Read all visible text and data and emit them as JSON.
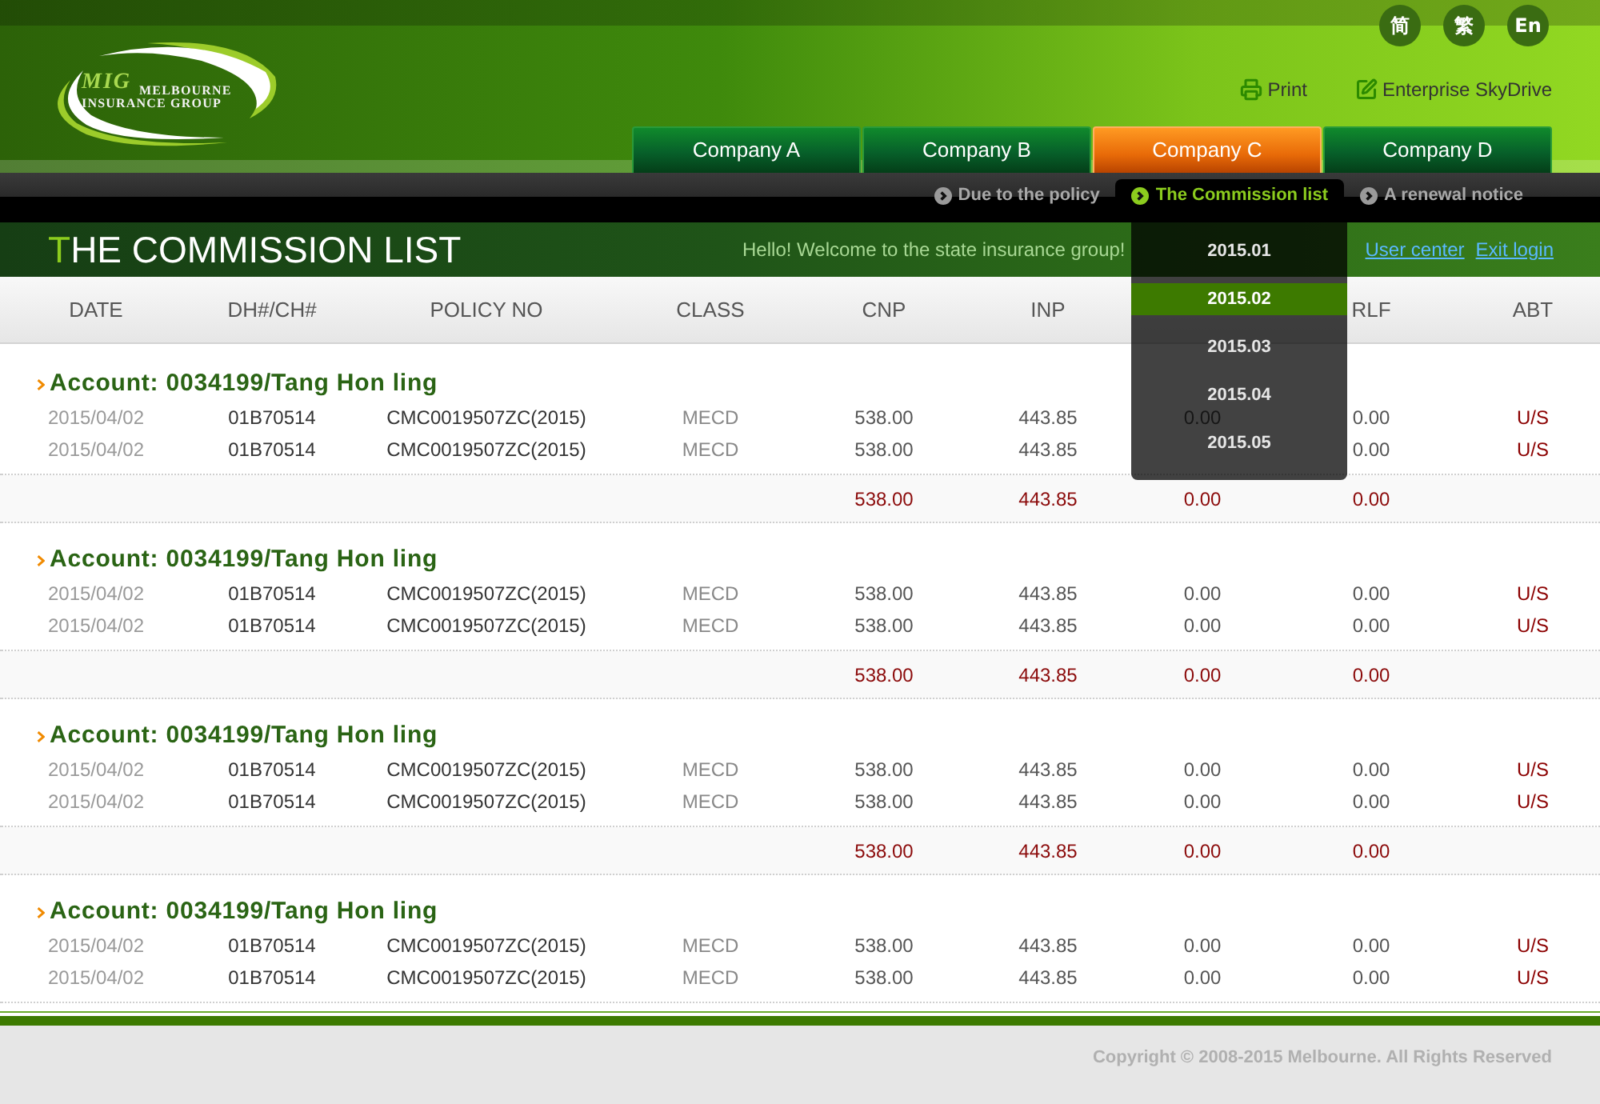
{
  "header": {
    "logo": {
      "mark": "MIG",
      "name": "MELBOURNE",
      "tagline": "INSURANCE GROUP"
    },
    "languages": [
      "简",
      "繁",
      "En"
    ],
    "tools": [
      {
        "kind": "print",
        "label": "Print"
      },
      {
        "kind": "edit",
        "label": "Enterprise SkyDrive"
      }
    ]
  },
  "tabs": [
    {
      "label": "Company A",
      "selected": false
    },
    {
      "label": "Company B",
      "selected": false
    },
    {
      "label": "Company C",
      "selected": true
    },
    {
      "label": "Company D",
      "selected": false
    }
  ],
  "subnav": [
    {
      "label": "Due to the policy",
      "selected": false
    },
    {
      "label": "The Commission list",
      "selected": true
    },
    {
      "label": "A renewal notice",
      "selected": false
    }
  ],
  "month_menu": {
    "items": [
      {
        "label": "2015.01",
        "selected": false
      },
      {
        "label": "2015.02",
        "selected": true
      },
      {
        "label": "2015.03",
        "selected": false
      },
      {
        "label": "2015.04",
        "selected": false
      },
      {
        "label": "2015.05",
        "selected": false
      }
    ]
  },
  "title_bar": {
    "title": "THE COMMISSION LIST",
    "welcome": "Hello! Welcome to the state insurance group!",
    "links": [
      "User center",
      "Exit login"
    ]
  },
  "table": {
    "columns": [
      "DATE",
      "DH#/CH#",
      "POLICY NO",
      "CLASS",
      "CNP",
      "INP",
      null,
      "RLF",
      "ABT"
    ],
    "groups": [
      {
        "account": "Account: 0034199/Tang Hon ling",
        "rows": [
          [
            "2015/04/02",
            "01B70514",
            "CMC0019507ZC(2015)",
            "MECD",
            "538.00",
            "443.85",
            "0.00",
            "0.00",
            "U/S"
          ],
          [
            "2015/04/02",
            "01B70514",
            "CMC0019507ZC(2015)",
            "MECD",
            "538.00",
            "443.85",
            null,
            "0.00",
            "U/S"
          ]
        ],
        "totals": [
          "538.00",
          "443.85",
          "0.00",
          "0.00"
        ]
      },
      {
        "account": "Account: 0034199/Tang Hon ling",
        "rows": [
          [
            "2015/04/02",
            "01B70514",
            "CMC0019507ZC(2015)",
            "MECD",
            "538.00",
            "443.85",
            "0.00",
            "0.00",
            "U/S"
          ],
          [
            "2015/04/02",
            "01B70514",
            "CMC0019507ZC(2015)",
            "MECD",
            "538.00",
            "443.85",
            "0.00",
            "0.00",
            "U/S"
          ]
        ],
        "totals": [
          "538.00",
          "443.85",
          "0.00",
          "0.00"
        ]
      },
      {
        "account": "Account: 0034199/Tang Hon ling",
        "rows": [
          [
            "2015/04/02",
            "01B70514",
            "CMC0019507ZC(2015)",
            "MECD",
            "538.00",
            "443.85",
            "0.00",
            "0.00",
            "U/S"
          ],
          [
            "2015/04/02",
            "01B70514",
            "CMC0019507ZC(2015)",
            "MECD",
            "538.00",
            "443.85",
            "0.00",
            "0.00",
            "U/S"
          ]
        ],
        "totals": [
          "538.00",
          "443.85",
          "0.00",
          "0.00"
        ]
      },
      {
        "account": "Account: 0034199/Tang Hon ling",
        "rows": [
          [
            "2015/04/02",
            "01B70514",
            "CMC0019507ZC(2015)",
            "MECD",
            "538.00",
            "443.85",
            "0.00",
            "0.00",
            "U/S"
          ],
          [
            "2015/04/02",
            "01B70514",
            "CMC0019507ZC(2015)",
            "MECD",
            "538.00",
            "443.85",
            "0.00",
            "0.00",
            "U/S"
          ]
        ]
      }
    ]
  },
  "footer": {
    "copyright": "Copyright © 2008-2015 Melbourne. All Rights Reserved"
  }
}
